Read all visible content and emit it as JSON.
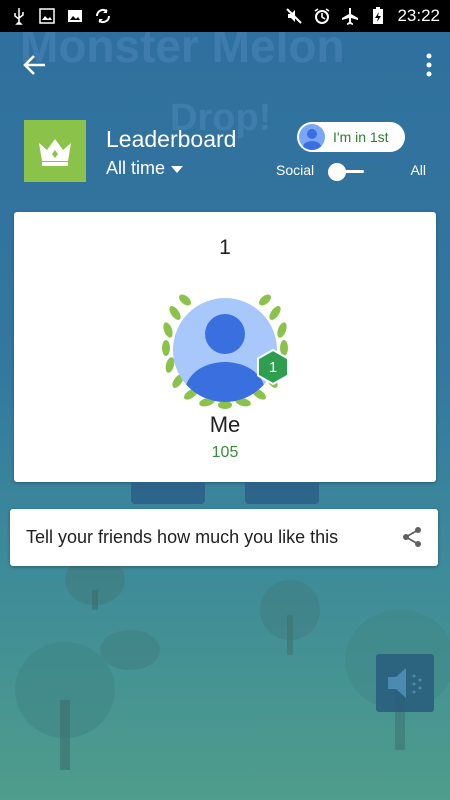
{
  "status_bar": {
    "time": "23:22"
  },
  "header": {
    "title": "Leaderboard",
    "time_filter": "All time",
    "player_pill_label": "I'm in 1st",
    "toggle_left": "Social",
    "toggle_right": "All"
  },
  "player_card": {
    "rank": "1",
    "badge": "1",
    "name": "Me",
    "score": "105"
  },
  "share": {
    "text": "Tell your friends how much you like this"
  },
  "colors": {
    "accent_green": "#8bc34a",
    "score_green": "#388e3c",
    "badge_green": "#2e9e4f"
  }
}
